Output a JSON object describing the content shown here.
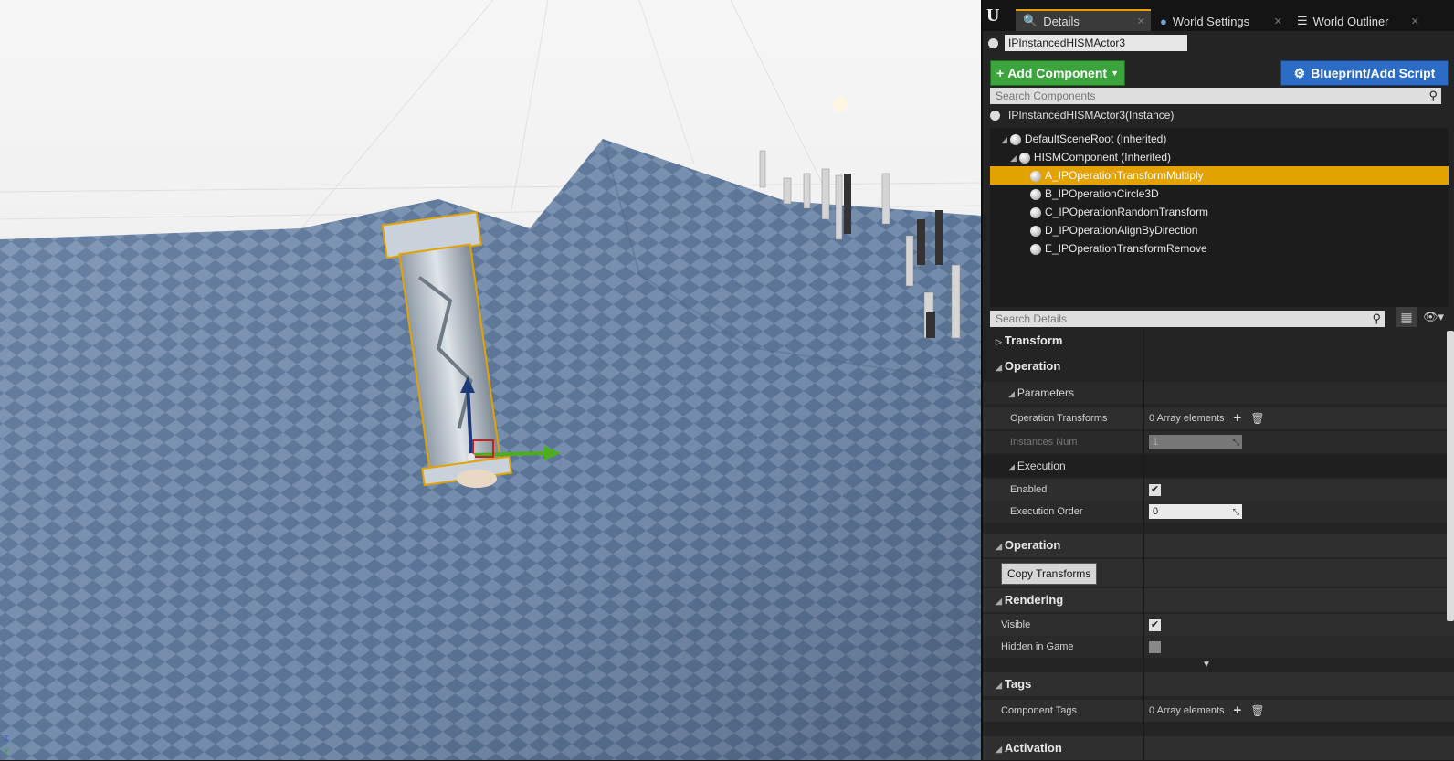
{
  "tabs": [
    {
      "label": "Details",
      "icon": "details-icon"
    },
    {
      "label": "World Settings",
      "icon": "globe-icon"
    },
    {
      "label": "World Outliner",
      "icon": "list-icon"
    }
  ],
  "actor_name": "IPInstancedHISMActor3",
  "toolbar": {
    "add_component": "Add Component",
    "blueprint": "Blueprint/Add Script"
  },
  "components_search_placeholder": "Search Components",
  "instance_label": "IPInstancedHISMActor3(Instance)",
  "tree": [
    {
      "label": "DefaultSceneRoot (Inherited)",
      "level": 0,
      "selected": false
    },
    {
      "label": "HISMComponent (Inherited)",
      "level": 1,
      "selected": false
    },
    {
      "label": "A_IPOperationTransformMultiply",
      "level": 2,
      "selected": true
    },
    {
      "label": "B_IPOperationCircle3D",
      "level": 2,
      "selected": false
    },
    {
      "label": "C_IPOperationRandomTransform",
      "level": 2,
      "selected": false
    },
    {
      "label": "D_IPOperationAlignByDirection",
      "level": 2,
      "selected": false
    },
    {
      "label": "E_IPOperationTransformRemove",
      "level": 2,
      "selected": false
    }
  ],
  "details_search_placeholder": "Search Details",
  "details": {
    "transform": "Transform",
    "operation": "Operation",
    "parameters": "Parameters",
    "operation_transforms": {
      "label": "Operation Transforms",
      "value": "0 Array elements"
    },
    "instances_num": {
      "label": "Instances Num",
      "value": "1"
    },
    "execution": "Execution",
    "enabled": {
      "label": "Enabled",
      "checked": true
    },
    "execution_order": {
      "label": "Execution Order",
      "value": "0"
    },
    "operation2": "Operation",
    "copy_transforms": "Copy Transforms",
    "rendering": "Rendering",
    "visible": {
      "label": "Visible",
      "checked": true
    },
    "hidden_in_game": {
      "label": "Hidden in Game",
      "checked": false
    },
    "tags": "Tags",
    "component_tags": {
      "label": "Component Tags",
      "value": "0 Array elements"
    },
    "activation": "Activation"
  },
  "viewport": {
    "axis_z": "Z",
    "axis_y": "Y"
  },
  "colors": {
    "accent": "#e3a200",
    "add_button": "#3ca43c",
    "blueprint_button": "#2a6cc6"
  }
}
